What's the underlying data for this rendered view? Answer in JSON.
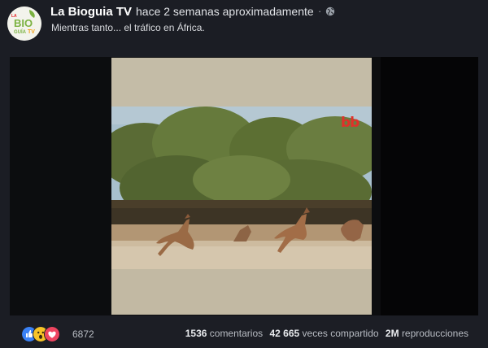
{
  "post": {
    "page_name": "La Bioguia TV",
    "separator": "·",
    "time": "hace 2 semanas aproximadamente",
    "separator2": "·",
    "caption": "Mientras tanto... el tráfico en África.",
    "privacy_icon": "globe-icon",
    "logo_text": {
      "small": "LA",
      "big": "BIO",
      "bottom": "GUÍA",
      "tv": "TV"
    }
  },
  "video": {
    "channel_logo": "bb",
    "colors": {
      "sky": "#9fb6c4",
      "trees": "#5f7036",
      "ground": "#bfa98a",
      "letterbox": "#0c0d0f"
    }
  },
  "reactions": {
    "icons": [
      "like-icon",
      "wow-icon",
      "love-icon"
    ],
    "count": "6872"
  },
  "stats": {
    "comments_count": "1536",
    "comments_label": "comentarios",
    "shares_count": "42 665",
    "shares_label": "veces compartido",
    "views_count": "2M",
    "views_label": "reproducciones"
  }
}
